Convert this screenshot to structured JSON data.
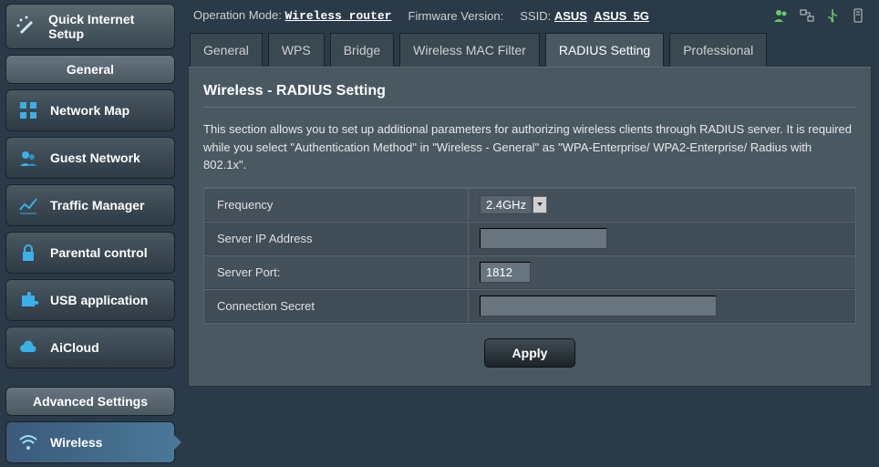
{
  "topbar": {
    "op_mode_label": "Operation Mode:",
    "op_mode_value": "Wireless router",
    "fw_label": "Firmware Version:",
    "ssid_label": "SSID:",
    "ssid1": "ASUS",
    "ssid2": "ASUS_5G"
  },
  "quick_setup": "Quick Internet Setup",
  "section_general": "General",
  "nav": {
    "network_map": "Network Map",
    "guest_network": "Guest Network",
    "traffic_manager": "Traffic Manager",
    "parental_control": "Parental control",
    "usb_application": "USB application",
    "aicloud": "AiCloud"
  },
  "section_advanced": "Advanced Settings",
  "nav_wireless": "Wireless",
  "tabs": {
    "general": "General",
    "wps": "WPS",
    "bridge": "Bridge",
    "mac_filter": "Wireless MAC Filter",
    "radius": "RADIUS Setting",
    "professional": "Professional"
  },
  "panel": {
    "title": "Wireless - RADIUS Setting",
    "desc": "This section allows you to set up additional parameters for authorizing wireless clients through RADIUS server. It is required while you select \"Authentication Method\" in \"Wireless - General\" as \"WPA-Enterprise/ WPA2-Enterprise/ Radius with 802.1x\"."
  },
  "form": {
    "frequency_label": "Frequency",
    "frequency_value": "2.4GHz",
    "server_ip_label": "Server IP Address",
    "server_ip_value": "",
    "server_port_label": "Server Port:",
    "server_port_value": "1812",
    "conn_secret_label": "Connection Secret",
    "conn_secret_value": ""
  },
  "apply_label": "Apply"
}
